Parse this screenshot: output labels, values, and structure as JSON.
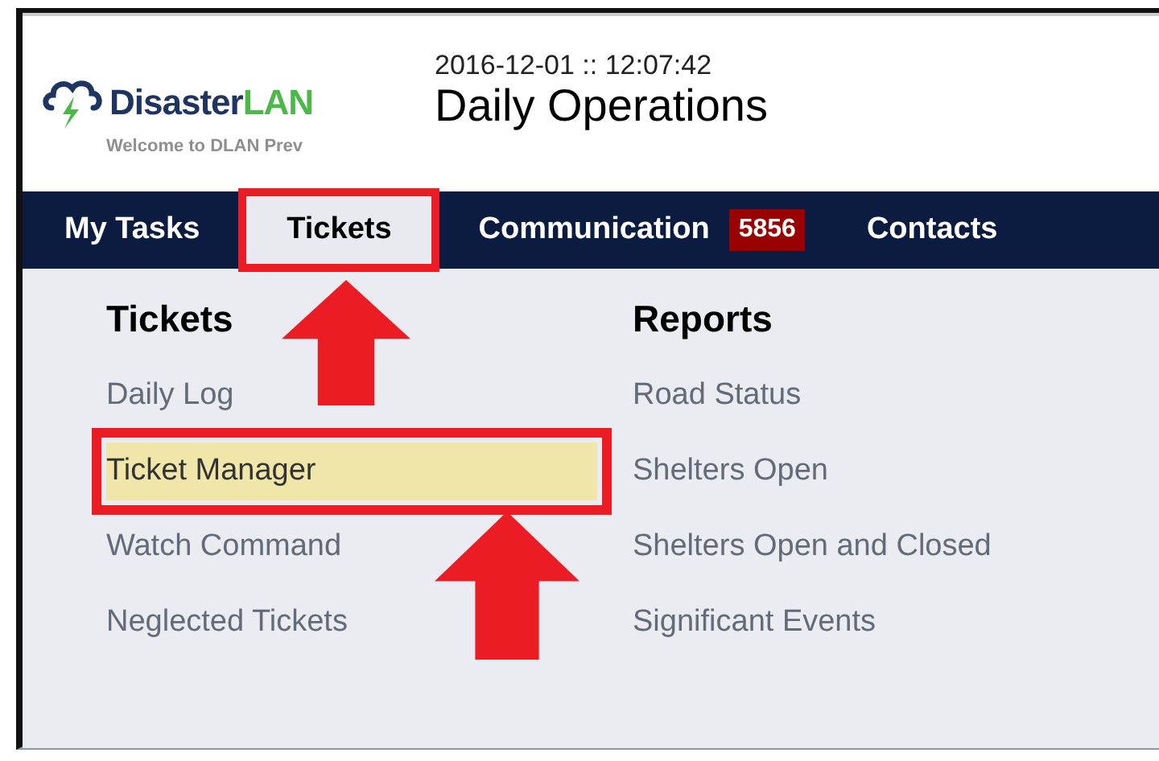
{
  "header": {
    "logo": {
      "name_part_1": "Disaster",
      "name_part_2": "LAN",
      "tagline": "Welcome to DLAN Prev"
    },
    "timestamp": "2016-12-01 :: 12:07:42",
    "title": "Daily Operations"
  },
  "nav": [
    {
      "label": "My Tasks",
      "selected": false,
      "annotated": false
    },
    {
      "label": "Tickets",
      "selected": true,
      "annotated": true
    },
    {
      "label": "Communication",
      "badge": "5856",
      "selected": false,
      "annotated": false
    },
    {
      "label": "Contacts",
      "selected": false,
      "annotated": false
    }
  ],
  "menu_columns": [
    {
      "heading": "Tickets",
      "items": [
        {
          "label": "Daily Log",
          "highlighted": false,
          "annotated": false
        },
        {
          "label": "Ticket Manager",
          "highlighted": true,
          "annotated": true
        },
        {
          "label": "Watch Command",
          "highlighted": false,
          "annotated": false
        },
        {
          "label": "Neglected Tickets",
          "highlighted": false,
          "annotated": false
        }
      ]
    },
    {
      "heading": "Reports",
      "items": [
        {
          "label": "Road Status",
          "highlighted": false,
          "annotated": false
        },
        {
          "label": "Shelters Open",
          "highlighted": false,
          "annotated": false
        },
        {
          "label": "Shelters Open and Closed",
          "highlighted": false,
          "annotated": false
        },
        {
          "label": "Significant Events",
          "highlighted": false,
          "annotated": false
        }
      ]
    }
  ]
}
